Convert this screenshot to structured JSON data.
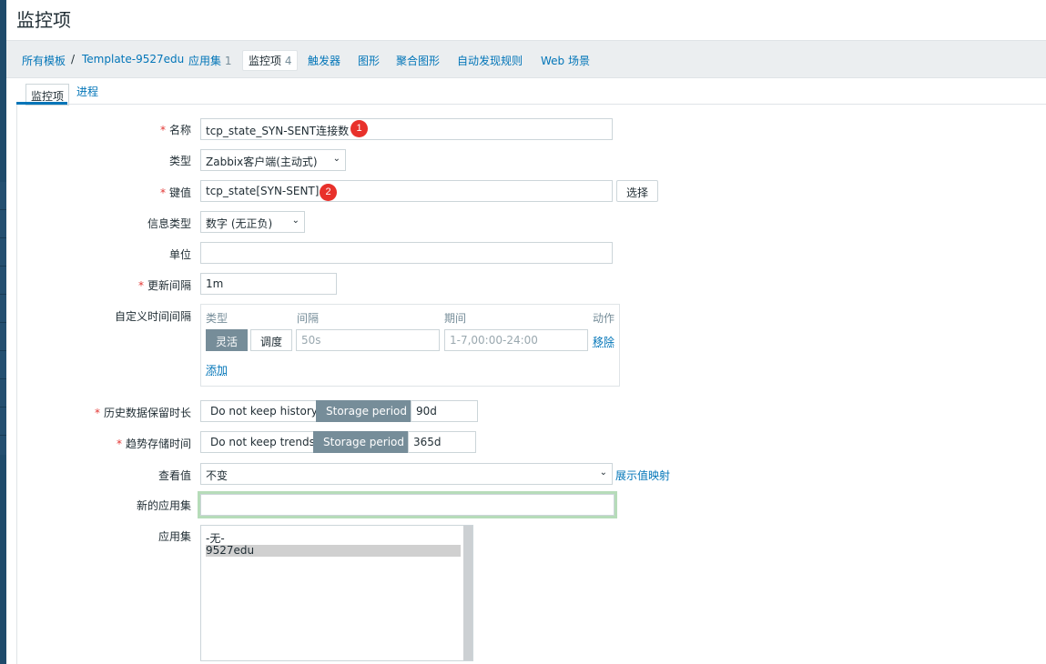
{
  "page_title": "监控项",
  "breadcrumbs": {
    "all_templates": "所有模板",
    "separator": "/",
    "template": "Template-9527edu",
    "applications": "应用集",
    "applications_count": "1",
    "items": "监控项",
    "items_count": "4",
    "triggers": "触发器",
    "graphs": "图形",
    "screens": "聚合图形",
    "discovery": "自动发现规则",
    "web": "Web 场景"
  },
  "subtabs": {
    "item": "监控项",
    "process": "进程"
  },
  "form": {
    "name_label": "名称",
    "name_value": "tcp_state_SYN-SENT连接数",
    "badge1": "1",
    "type_label": "类型",
    "type_value": "Zabbix客户端(主动式)",
    "key_label": "键值",
    "key_value": "tcp_state[SYN-SENT]",
    "badge2": "2",
    "select_button": "选择",
    "info_type_label": "信息类型",
    "info_type_value": "数字 (无正负)",
    "units_label": "单位",
    "units_value": "",
    "interval_label": "更新间隔",
    "interval_value": "1m",
    "custom_intervals_label": "自定义时间间隔",
    "custom_intervals": {
      "col_type": "类型",
      "col_interval": "间隔",
      "col_period": "期间",
      "col_action": "动作",
      "flexible": "灵活",
      "scheduling": "调度",
      "interval_placeholder": "50s",
      "period_placeholder": "1-7,00:00-24:00",
      "remove": "移除",
      "add": "添加"
    },
    "history_label": "历史数据保留时长",
    "history_no_keep": "Do not keep history",
    "history_storage": "Storage period",
    "history_value": "90d",
    "trends_label": "趋势存储时间",
    "trends_no_keep": "Do not keep trends",
    "trends_storage": "Storage period",
    "trends_value": "365d",
    "valuemap_label": "查看值",
    "valuemap_value": "不变",
    "valuemap_link": "展示值映射",
    "new_app_label": "新的应用集",
    "new_app_value": "",
    "apps_label": "应用集",
    "apps_options": [
      "-无-",
      "9527edu"
    ]
  },
  "colors": {
    "link": "#0275b8",
    "required": "#e33734",
    "badge": "#e8312b",
    "segment_on": "#768d99",
    "new_app_border": "#b6dcb9"
  }
}
